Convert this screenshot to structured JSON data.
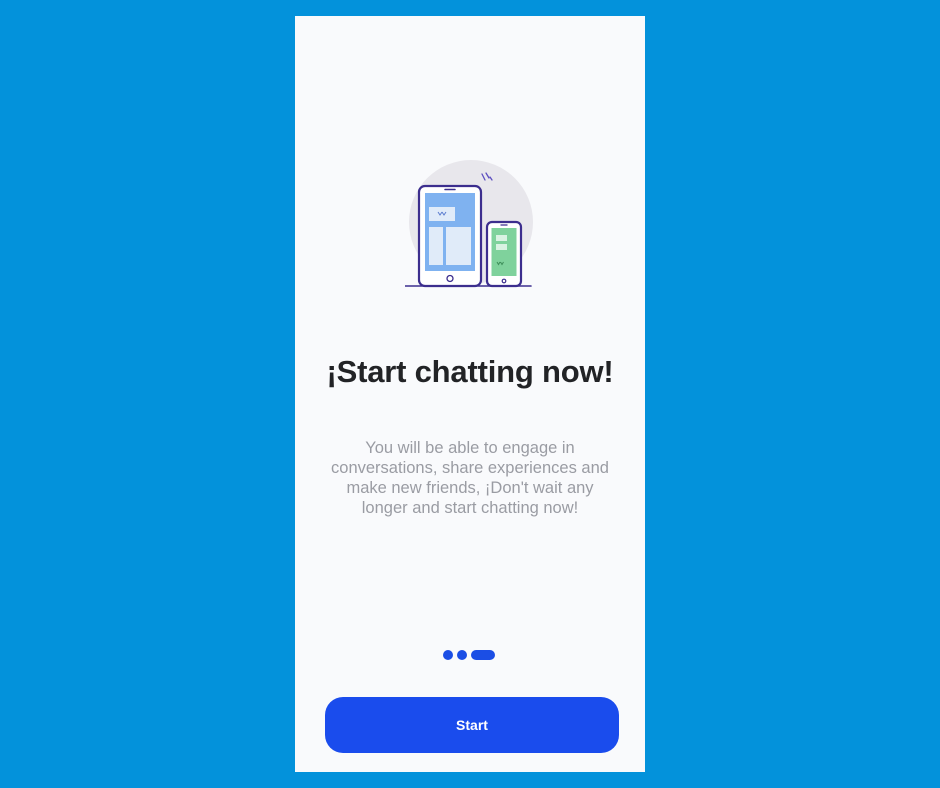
{
  "onboarding": {
    "title": "¡Start chatting now!",
    "description": "You will be able to engage in conversations, share experiences and make new friends, ¡Don't wait any longer and start chatting now!",
    "pager": {
      "total": 3,
      "current": 3
    },
    "start_label": "Start"
  },
  "colors": {
    "background": "#0392db",
    "card": "#f9fafc",
    "accent": "#1a4ced",
    "title": "#222326",
    "description": "#9a9ca3"
  }
}
